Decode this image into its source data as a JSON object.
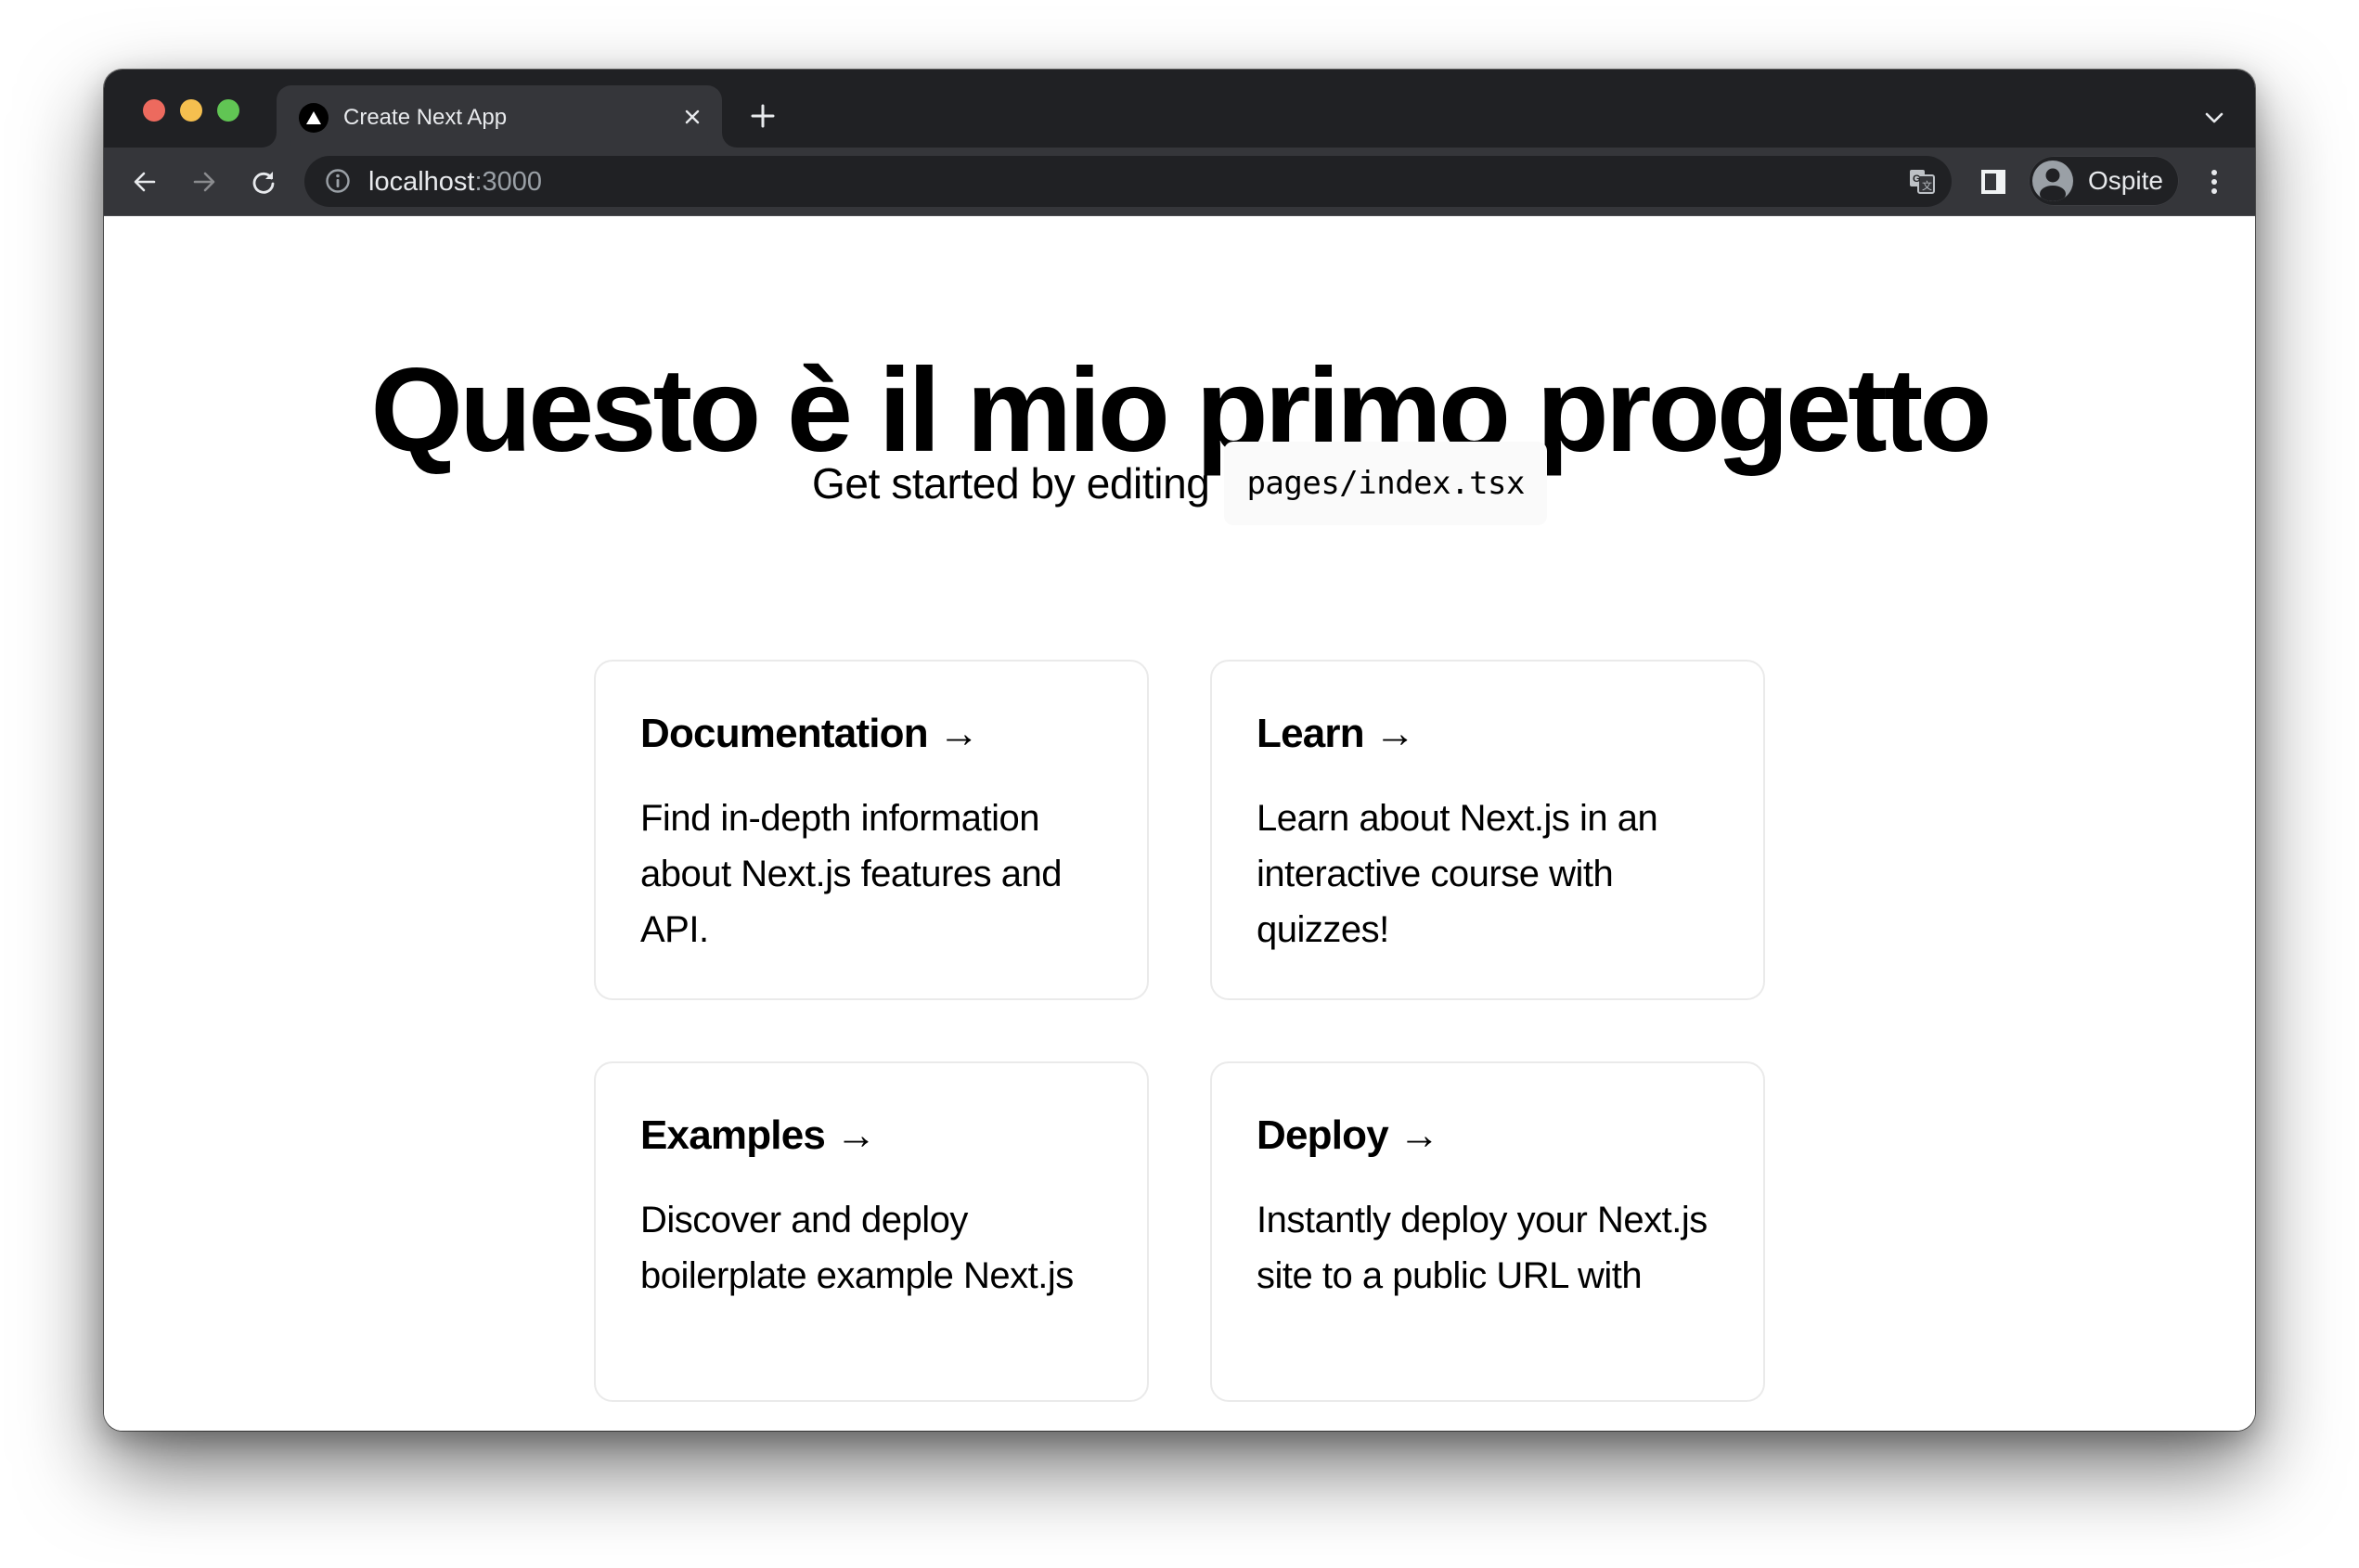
{
  "window": {
    "traffic_lights": [
      "close",
      "minimize",
      "zoom"
    ]
  },
  "tab": {
    "title": "Create Next App",
    "favicon": "nextjs-triangle-icon",
    "close_icon": "close-icon"
  },
  "toolbar": {
    "url_host": "localhost",
    "url_port": ":3000",
    "profile_name": "Ospite",
    "icons": [
      "back-arrow-icon",
      "forward-arrow-icon",
      "reload-icon",
      "info-icon",
      "translate-icon",
      "side-panel-icon",
      "avatar-icon",
      "more-vert-icon"
    ]
  },
  "page": {
    "title": "Questo è il mio primo progetto",
    "subtitle": "Get started by editing",
    "code": "pages/index.tsx",
    "cards": [
      {
        "title": "Documentation →",
        "body": "Find in-depth information about Next.js features and API."
      },
      {
        "title": "Learn →",
        "body": "Learn about Next.js in an interactive course with quizzes!"
      },
      {
        "title": "Examples →",
        "body": "Discover and deploy boilerplate example Next.js"
      },
      {
        "title": "Deploy →",
        "body": "Instantly deploy your Next.js site to a public URL with"
      }
    ]
  },
  "colors": {
    "tabstrip_bg": "#202124",
    "toolbar_bg": "#35363a",
    "omnibox_bg": "#202124",
    "text_light": "#e8eaed",
    "text_muted": "#9aa0a6",
    "card_border": "#eaeaea",
    "code_bg": "#fafafa"
  }
}
